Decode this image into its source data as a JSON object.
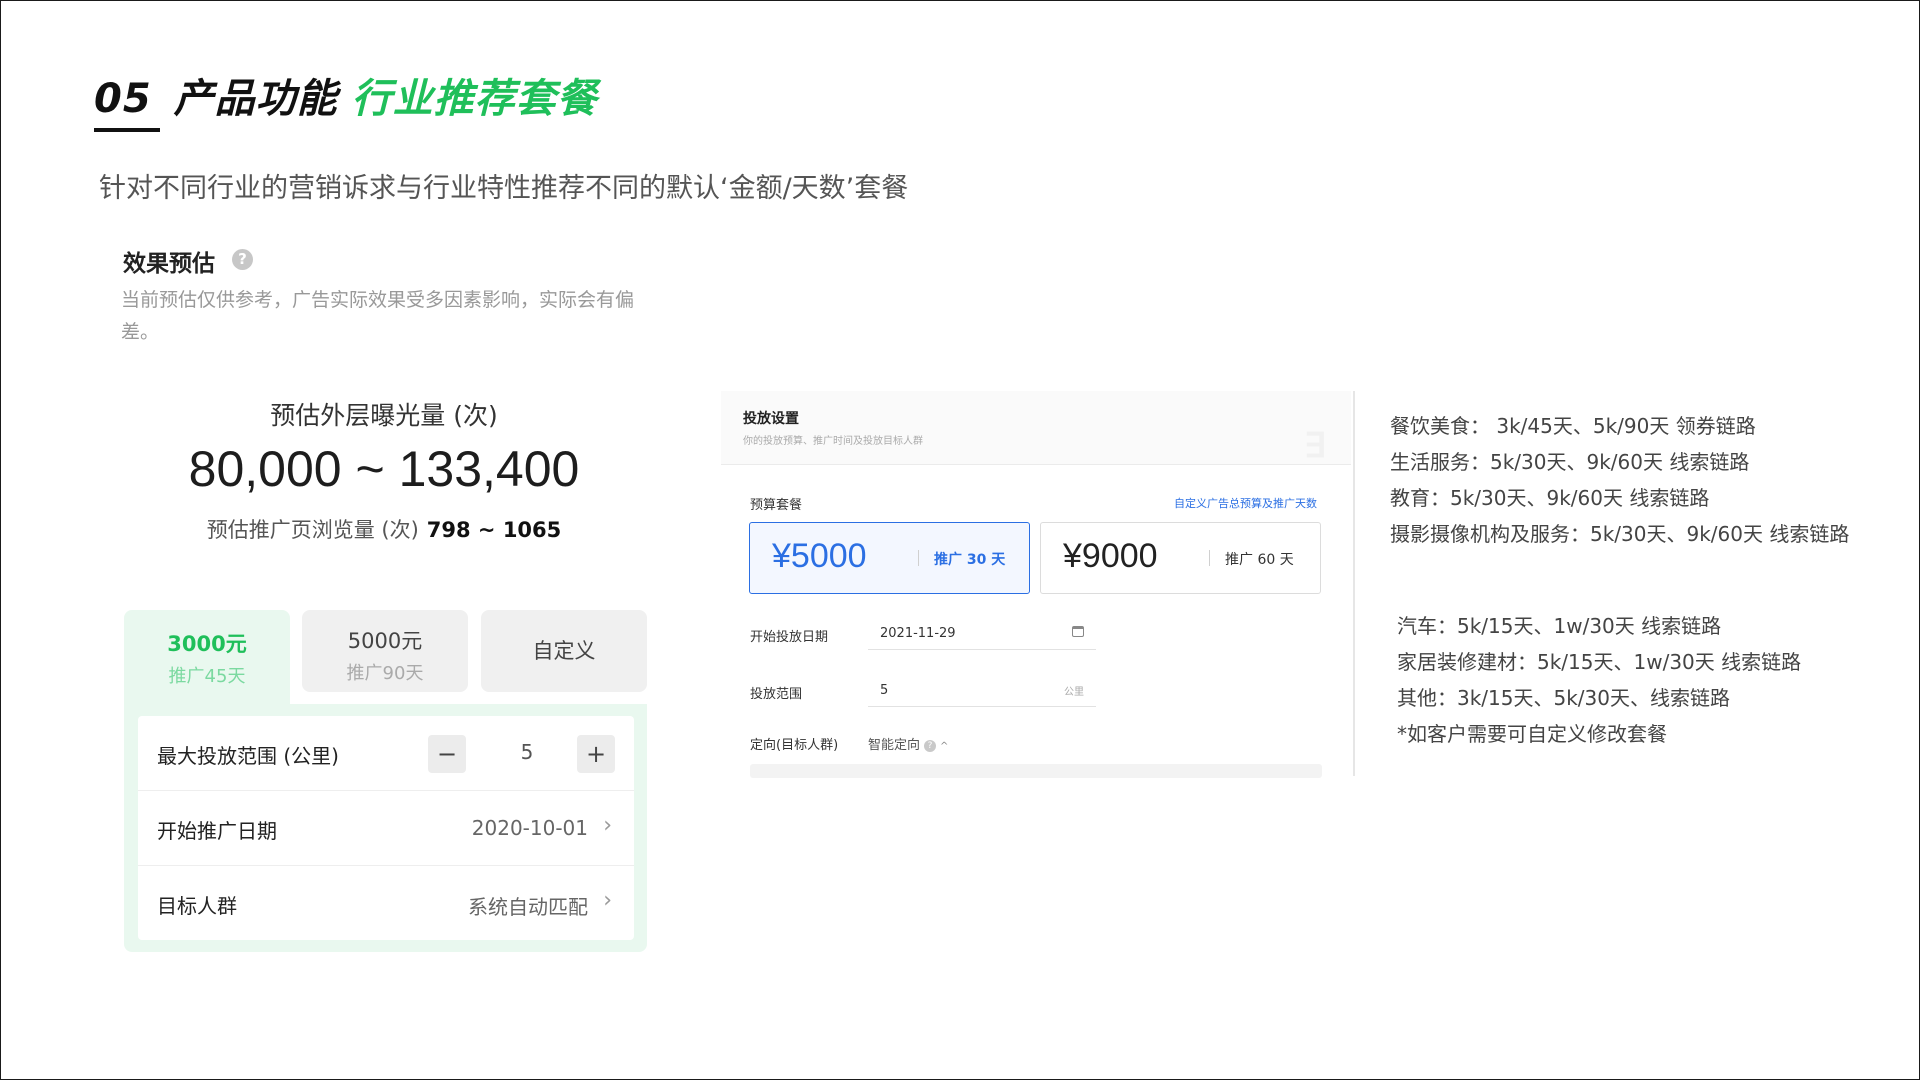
{
  "slide": {
    "number": "05",
    "title_main": "产品功能",
    "title_highlight": "行业推荐套餐",
    "subtitle": "针对不同行业的营销诉求与行业特性推荐不同的默认‘金额/天数’套餐"
  },
  "mobile_card": {
    "section_title": "效果预估",
    "help_icon": "?",
    "desc": "当前预估仅供参考，广告实际效果受多因素影响，实际会有偏差。",
    "exposure_label": "预估外层曝光量 (次)",
    "exposure_range": "80,000 ~ 133,400",
    "pageview_label": "预估推广页浏览量 (次)",
    "pageview_range": "798 ~ 1065",
    "packages": [
      {
        "amount": "3000元",
        "days": "推广45天",
        "active": true
      },
      {
        "amount": "5000元",
        "days": "推广90天",
        "active": false
      },
      {
        "label": "自定义"
      }
    ],
    "range_row": {
      "label": "最大投放范围 (公里)",
      "minus": "−",
      "value": "5",
      "plus": "+"
    },
    "date_row": {
      "label": "开始推广日期",
      "value": "2020-10-01",
      "chevron": "›"
    },
    "audience_row": {
      "label": "目标人群",
      "value": "系统自动匹配",
      "chevron": "›"
    }
  },
  "web_panel": {
    "title": "投放设置",
    "desc": "你的投放预算、推广时间及投放目标人群",
    "watermark": "∃",
    "budget_label": "预算套餐",
    "custom_link": "自定义广告总预算及推广天数",
    "options": [
      {
        "price": "¥5000",
        "duration": "推广 30 天",
        "selected": true
      },
      {
        "price": "¥9000",
        "duration": "推广 60 天",
        "selected": false
      }
    ],
    "start_date_label": "开始投放日期",
    "start_date_value": "2021-11-29",
    "calendar_icon": "calendar-icon",
    "range_label": "投放范围",
    "range_value": "5",
    "range_unit": "公里",
    "target_label": "定向(目标人群)",
    "target_value": "智能定向",
    "target_help": "?",
    "target_chevron": "^"
  },
  "notes": {
    "group_a": [
      "餐饮美食： 3k/45天、5k/90天 领券链路",
      "生活服务：5k/30天、9k/60天 线索链路",
      "教育：5k/30天、9k/60天 线索链路",
      "摄影摄像机构及服务：5k/30天、9k/60天 线索链路"
    ],
    "group_b": [
      "汽车：5k/15天、1w/30天 线索链路",
      "家居装修建材：5k/15天、1w/30天 线索链路",
      "其他：3k/15天、5k/30天、线索链路",
      "*如客户需要可自定义修改套餐"
    ]
  }
}
